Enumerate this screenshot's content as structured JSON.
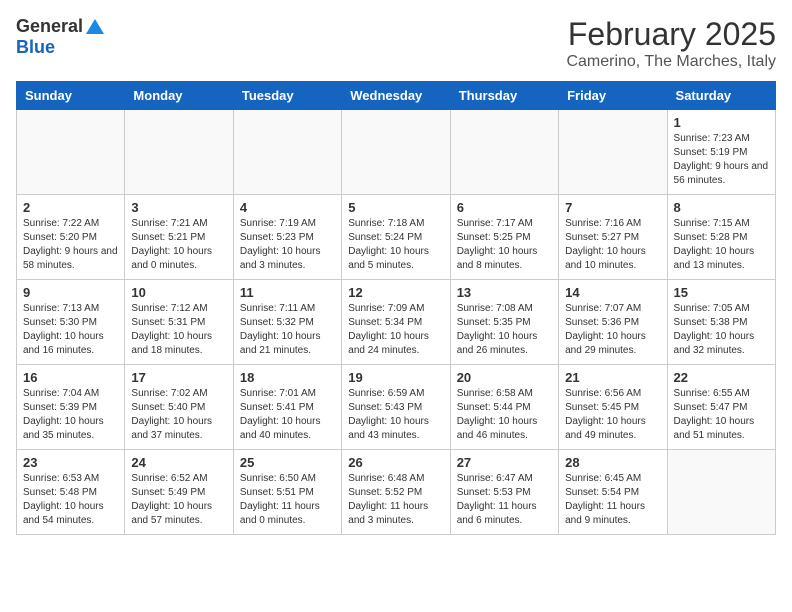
{
  "header": {
    "logo_general": "General",
    "logo_blue": "Blue",
    "title": "February 2025",
    "subtitle": "Camerino, The Marches, Italy"
  },
  "calendar": {
    "days_of_week": [
      "Sunday",
      "Monday",
      "Tuesday",
      "Wednesday",
      "Thursday",
      "Friday",
      "Saturday"
    ],
    "weeks": [
      [
        {
          "day": "",
          "info": ""
        },
        {
          "day": "",
          "info": ""
        },
        {
          "day": "",
          "info": ""
        },
        {
          "day": "",
          "info": ""
        },
        {
          "day": "",
          "info": ""
        },
        {
          "day": "",
          "info": ""
        },
        {
          "day": "1",
          "info": "Sunrise: 7:23 AM\nSunset: 5:19 PM\nDaylight: 9 hours and 56 minutes."
        }
      ],
      [
        {
          "day": "2",
          "info": "Sunrise: 7:22 AM\nSunset: 5:20 PM\nDaylight: 9 hours and 58 minutes."
        },
        {
          "day": "3",
          "info": "Sunrise: 7:21 AM\nSunset: 5:21 PM\nDaylight: 10 hours and 0 minutes."
        },
        {
          "day": "4",
          "info": "Sunrise: 7:19 AM\nSunset: 5:23 PM\nDaylight: 10 hours and 3 minutes."
        },
        {
          "day": "5",
          "info": "Sunrise: 7:18 AM\nSunset: 5:24 PM\nDaylight: 10 hours and 5 minutes."
        },
        {
          "day": "6",
          "info": "Sunrise: 7:17 AM\nSunset: 5:25 PM\nDaylight: 10 hours and 8 minutes."
        },
        {
          "day": "7",
          "info": "Sunrise: 7:16 AM\nSunset: 5:27 PM\nDaylight: 10 hours and 10 minutes."
        },
        {
          "day": "8",
          "info": "Sunrise: 7:15 AM\nSunset: 5:28 PM\nDaylight: 10 hours and 13 minutes."
        }
      ],
      [
        {
          "day": "9",
          "info": "Sunrise: 7:13 AM\nSunset: 5:30 PM\nDaylight: 10 hours and 16 minutes."
        },
        {
          "day": "10",
          "info": "Sunrise: 7:12 AM\nSunset: 5:31 PM\nDaylight: 10 hours and 18 minutes."
        },
        {
          "day": "11",
          "info": "Sunrise: 7:11 AM\nSunset: 5:32 PM\nDaylight: 10 hours and 21 minutes."
        },
        {
          "day": "12",
          "info": "Sunrise: 7:09 AM\nSunset: 5:34 PM\nDaylight: 10 hours and 24 minutes."
        },
        {
          "day": "13",
          "info": "Sunrise: 7:08 AM\nSunset: 5:35 PM\nDaylight: 10 hours and 26 minutes."
        },
        {
          "day": "14",
          "info": "Sunrise: 7:07 AM\nSunset: 5:36 PM\nDaylight: 10 hours and 29 minutes."
        },
        {
          "day": "15",
          "info": "Sunrise: 7:05 AM\nSunset: 5:38 PM\nDaylight: 10 hours and 32 minutes."
        }
      ],
      [
        {
          "day": "16",
          "info": "Sunrise: 7:04 AM\nSunset: 5:39 PM\nDaylight: 10 hours and 35 minutes."
        },
        {
          "day": "17",
          "info": "Sunrise: 7:02 AM\nSunset: 5:40 PM\nDaylight: 10 hours and 37 minutes."
        },
        {
          "day": "18",
          "info": "Sunrise: 7:01 AM\nSunset: 5:41 PM\nDaylight: 10 hours and 40 minutes."
        },
        {
          "day": "19",
          "info": "Sunrise: 6:59 AM\nSunset: 5:43 PM\nDaylight: 10 hours and 43 minutes."
        },
        {
          "day": "20",
          "info": "Sunrise: 6:58 AM\nSunset: 5:44 PM\nDaylight: 10 hours and 46 minutes."
        },
        {
          "day": "21",
          "info": "Sunrise: 6:56 AM\nSunset: 5:45 PM\nDaylight: 10 hours and 49 minutes."
        },
        {
          "day": "22",
          "info": "Sunrise: 6:55 AM\nSunset: 5:47 PM\nDaylight: 10 hours and 51 minutes."
        }
      ],
      [
        {
          "day": "23",
          "info": "Sunrise: 6:53 AM\nSunset: 5:48 PM\nDaylight: 10 hours and 54 minutes."
        },
        {
          "day": "24",
          "info": "Sunrise: 6:52 AM\nSunset: 5:49 PM\nDaylight: 10 hours and 57 minutes."
        },
        {
          "day": "25",
          "info": "Sunrise: 6:50 AM\nSunset: 5:51 PM\nDaylight: 11 hours and 0 minutes."
        },
        {
          "day": "26",
          "info": "Sunrise: 6:48 AM\nSunset: 5:52 PM\nDaylight: 11 hours and 3 minutes."
        },
        {
          "day": "27",
          "info": "Sunrise: 6:47 AM\nSunset: 5:53 PM\nDaylight: 11 hours and 6 minutes."
        },
        {
          "day": "28",
          "info": "Sunrise: 6:45 AM\nSunset: 5:54 PM\nDaylight: 11 hours and 9 minutes."
        },
        {
          "day": "",
          "info": ""
        }
      ]
    ]
  }
}
